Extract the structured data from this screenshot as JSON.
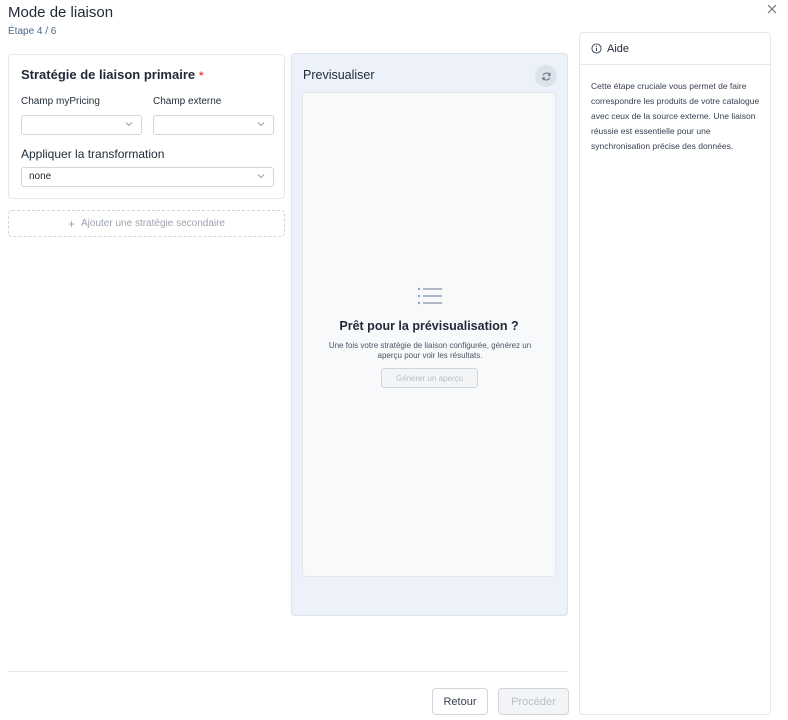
{
  "header": {
    "title": "Mode de liaison",
    "step": "Étape 4 / 6",
    "close_icon": "close-icon"
  },
  "strategy": {
    "title": "Stratégie de liaison primaire",
    "required_mark": "*",
    "mypricing_label": "Champ myPricing",
    "mypricing_value": "",
    "external_label": "Champ externe",
    "external_value": "",
    "transform_label": "Appliquer la transformation",
    "transform_value": "none",
    "add_secondary_label": "Ajouter une stratégie secondaire"
  },
  "preview": {
    "title": "Previsualiser",
    "refresh_icon": "refresh-icon",
    "empty_icon": "list-icon",
    "ready_title": "Prêt pour la prévisualisation ?",
    "ready_desc_line1": "Une fois votre stratégie de liaison configurée, générez un",
    "ready_desc_line2": "aperçu pour voir les résultats.",
    "generate_label": "Générer un aperçu"
  },
  "help": {
    "icon": "info-icon",
    "title": "Aide",
    "text": "Cette étape cruciale vous permet de faire correspondre les produits de votre catalogue avec ceux de la source externe. Une liaison réussie est essentielle pour une synchronisation précise des données."
  },
  "footer": {
    "back_label": "Retour",
    "proceed_label": "Procéder"
  },
  "colors": {
    "preview_bg": "#edf2fa",
    "required": "#ef4444",
    "step_text": "#4a6a8c"
  }
}
